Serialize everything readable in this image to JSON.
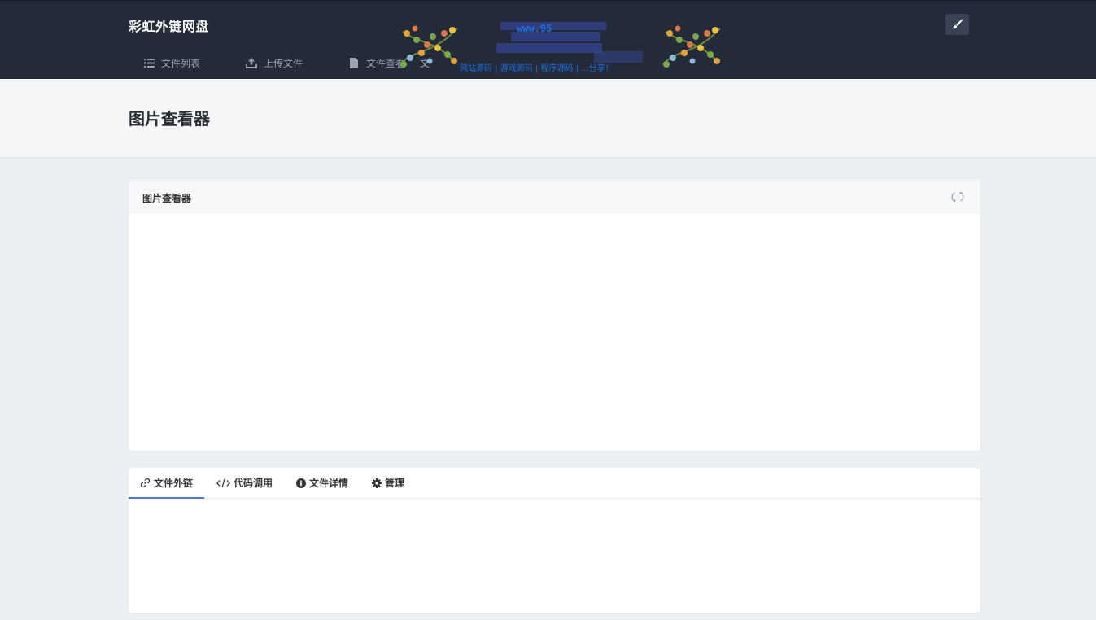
{
  "header": {
    "brand": "彩虹外链网盘",
    "nav": [
      {
        "label": "文件列表",
        "icon": "list-icon"
      },
      {
        "label": "上传文件",
        "icon": "upload-icon"
      },
      {
        "label": "文件查看",
        "icon": "file-icon"
      }
    ],
    "nav_partial": "文",
    "brush_icon": "brush-icon"
  },
  "ad": {
    "text_top": "www.95",
    "text_bottom": "网站源码 | 游戏源码 | 程序源码 | ...分享！"
  },
  "page": {
    "title": "图片查看器"
  },
  "viewer_card": {
    "title": "图片查看器",
    "refresh_icon": "refresh-icon"
  },
  "tabs": [
    {
      "label": "文件外链",
      "icon": "link-icon",
      "active": true
    },
    {
      "label": "代码调用",
      "icon": "code-icon",
      "active": false
    },
    {
      "label": "文件详情",
      "icon": "info-icon",
      "active": false
    },
    {
      "label": "管理",
      "icon": "gear-icon",
      "active": false
    }
  ],
  "colors": {
    "header_bg": "#232a38",
    "accent": "#4a7ad6",
    "page_bg": "#ebeef2"
  }
}
